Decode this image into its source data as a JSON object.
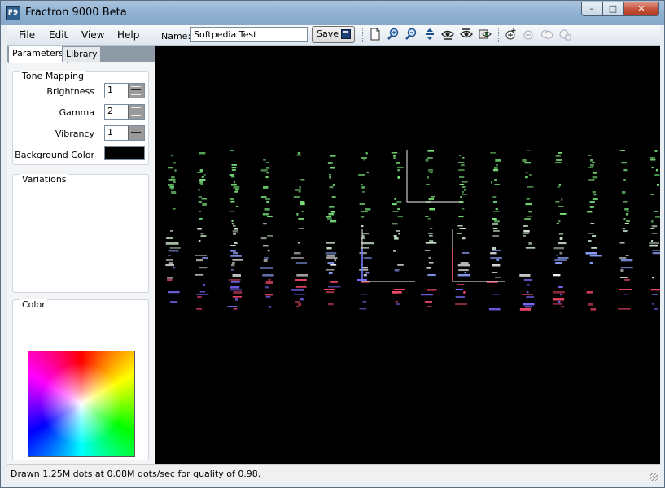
{
  "window": {
    "title": "Fractron 9000 Beta",
    "app_icon_text": "F9"
  },
  "menu": {
    "file": "File",
    "edit": "Edit",
    "view": "View",
    "help": "Help"
  },
  "toolbar": {
    "name_label": "Name:",
    "name_value": "Softpedia Test",
    "save_label": "Save",
    "icons": [
      "new-document-icon",
      "zoom-in-icon",
      "zoom-out-icon",
      "fit-vertical-icon",
      "preview-icon",
      "preview-alt-icon",
      "render-icon",
      "add-transform-icon",
      "remove-transform-icon",
      "duplicate-transform-icon",
      "transform-settings-icon"
    ]
  },
  "tabs": {
    "parameters": "Parameters",
    "library": "Library"
  },
  "tone_mapping": {
    "title": "Tone Mapping",
    "brightness_label": "Brightness",
    "brightness_value": "1",
    "gamma_label": "Gamma",
    "gamma_value": "2",
    "vibrancy_label": "Vibrancy",
    "vibrancy_value": "1",
    "background_label": "Background Color",
    "background_color": "#000000"
  },
  "variations": {
    "title": "Variations"
  },
  "color_section": {
    "title": "Color"
  },
  "status": {
    "text": "Drawn  1.25M dots at  0.08M dots/sec for quality of  0.98."
  }
}
